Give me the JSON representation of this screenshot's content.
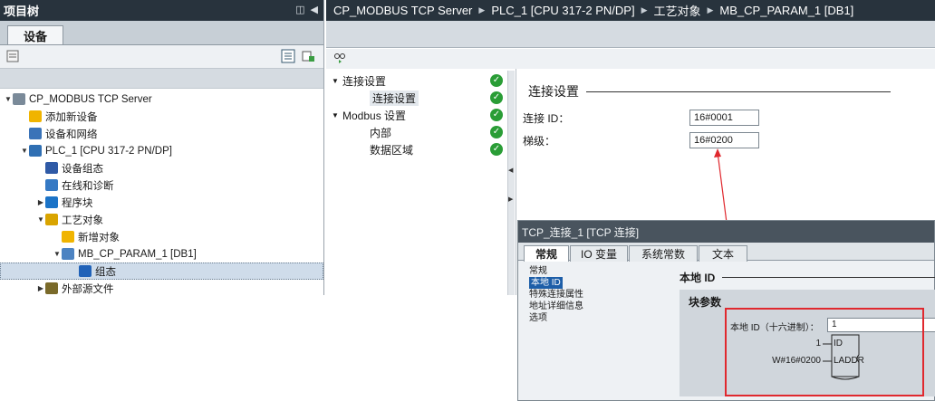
{
  "project_tree": {
    "title": "项目树",
    "tab": "设备",
    "items": [
      {
        "label": "CP_MODBUS TCP Server",
        "indent": 0,
        "twisty": "▼"
      },
      {
        "label": "添加新设备",
        "indent": 1,
        "twisty": ""
      },
      {
        "label": "设备和网络",
        "indent": 1,
        "twisty": ""
      },
      {
        "label": "PLC_1 [CPU 317-2 PN/DP]",
        "indent": 1,
        "twisty": "▼"
      },
      {
        "label": "设备组态",
        "indent": 2,
        "twisty": ""
      },
      {
        "label": "在线和诊断",
        "indent": 2,
        "twisty": ""
      },
      {
        "label": "程序块",
        "indent": 2,
        "twisty": "▶"
      },
      {
        "label": "工艺对象",
        "indent": 2,
        "twisty": "▼"
      },
      {
        "label": "新增对象",
        "indent": 3,
        "twisty": ""
      },
      {
        "label": "MB_CP_PARAM_1 [DB1]",
        "indent": 3,
        "twisty": "▼"
      },
      {
        "label": "组态",
        "indent": 4,
        "twisty": "",
        "selected": true
      },
      {
        "label": "外部源文件",
        "indent": 2,
        "twisty": "▶"
      }
    ]
  },
  "breadcrumb": [
    "CP_MODBUS TCP Server",
    "PLC_1 [CPU 317-2 PN/DP]",
    "工艺对象",
    "MB_CP_PARAM_1 [DB1]"
  ],
  "config_nav": [
    {
      "label": "连接设置",
      "level": 0,
      "twisty": "▼"
    },
    {
      "label": "连接设置",
      "level": 1,
      "twisty": "",
      "selected": true
    },
    {
      "label": "Modbus 设置",
      "level": 0,
      "twisty": "▼"
    },
    {
      "label": "内部",
      "level": 1,
      "twisty": ""
    },
    {
      "label": "数据区域",
      "level": 1,
      "twisty": ""
    }
  ],
  "connection": {
    "section_title": "连接设置",
    "id_label": "连接 ID：",
    "id_value": "16#0001",
    "ladder_label": "梯级：",
    "ladder_value": "16#0200"
  },
  "dialog": {
    "title": "TCP_连接_1 [TCP 连接]",
    "tabs": [
      "常规",
      "IO 变量",
      "系统常数",
      "文本"
    ],
    "nav": [
      "常规",
      "本地 ID",
      "特殊连接属性",
      "地址详细信息",
      "选项"
    ],
    "section": "本地 ID",
    "block_heading": "块参数",
    "local_id_label": "本地 ID（十六进制）：",
    "local_id_value": "1",
    "pin_id_value": "1",
    "pin_id_name": "ID",
    "pin_laddr_value": "W#16#0200",
    "pin_laddr_name": "LADDR"
  },
  "colors": {
    "titlebar": "#28333d",
    "check": "#2a9d36",
    "highlight": "#e0282e",
    "selected_nav": "#1d5ea8"
  }
}
